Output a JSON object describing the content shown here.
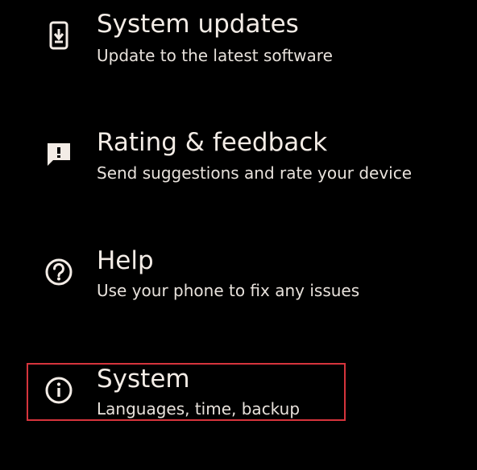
{
  "settings": {
    "items": [
      {
        "icon": "system-update-icon",
        "title": "System updates",
        "subtitle": "Update to the latest software"
      },
      {
        "icon": "feedback-icon",
        "title": "Rating & feedback",
        "subtitle": "Send suggestions and rate your device"
      },
      {
        "icon": "help-icon",
        "title": "Help",
        "subtitle": "Use your phone to fix any issues"
      },
      {
        "icon": "info-icon",
        "title": "System",
        "subtitle": "Languages, time, backup"
      }
    ]
  },
  "colors": {
    "background": "#000000",
    "text": "#f3ece6",
    "highlight_border": "#d6343c"
  }
}
